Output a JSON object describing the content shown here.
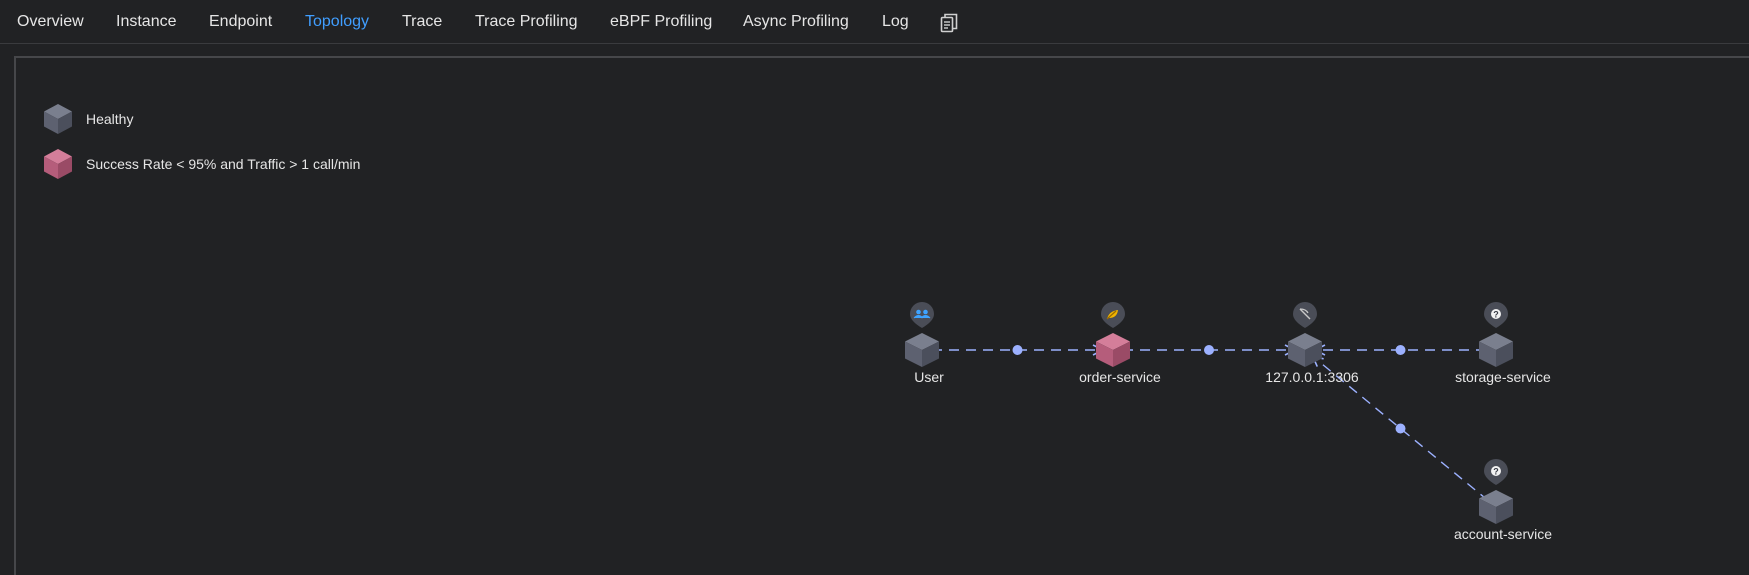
{
  "tabs": [
    {
      "label": "Overview",
      "active": false
    },
    {
      "label": "Instance",
      "active": false
    },
    {
      "label": "Endpoint",
      "active": false
    },
    {
      "label": "Topology",
      "active": true
    },
    {
      "label": "Trace",
      "active": false
    },
    {
      "label": "Trace Profiling",
      "active": false
    },
    {
      "label": "eBPF Profiling",
      "active": false
    },
    {
      "label": "Async Profiling",
      "active": false
    },
    {
      "label": "Log",
      "active": false
    }
  ],
  "tab_extra_icon": "copy-document-icon",
  "legend": [
    {
      "label": "Healthy",
      "color": "#5d6170",
      "icon": "cube-icon"
    },
    {
      "label": "Success Rate < 95% and Traffic > 1 call/min",
      "color": "#b55d7b",
      "icon": "cube-icon"
    }
  ],
  "colors": {
    "background": "#212224",
    "active_tab": "#409eff",
    "healthy": "#5d6170",
    "unhealthy": "#b55d7b",
    "link": "#9cb1ff"
  },
  "topology": {
    "nodes": [
      {
        "id": "user",
        "label": "User",
        "status": "healthy",
        "badge": "users-icon"
      },
      {
        "id": "order",
        "label": "order-service",
        "status": "unhealthy",
        "badge": "spring-icon"
      },
      {
        "id": "mysql",
        "label": "127.0.0.1:3306",
        "status": "healthy",
        "badge": "database-feather-icon"
      },
      {
        "id": "storage",
        "label": "storage-service",
        "status": "healthy",
        "badge": "unknown-service-icon"
      },
      {
        "id": "account",
        "label": "account-service",
        "status": "healthy",
        "badge": "unknown-service-icon"
      }
    ],
    "links": [
      {
        "source": "user",
        "target": "order"
      },
      {
        "source": "order",
        "target": "mysql"
      },
      {
        "source": "storage",
        "target": "mysql"
      },
      {
        "source": "account",
        "target": "mysql"
      }
    ]
  }
}
